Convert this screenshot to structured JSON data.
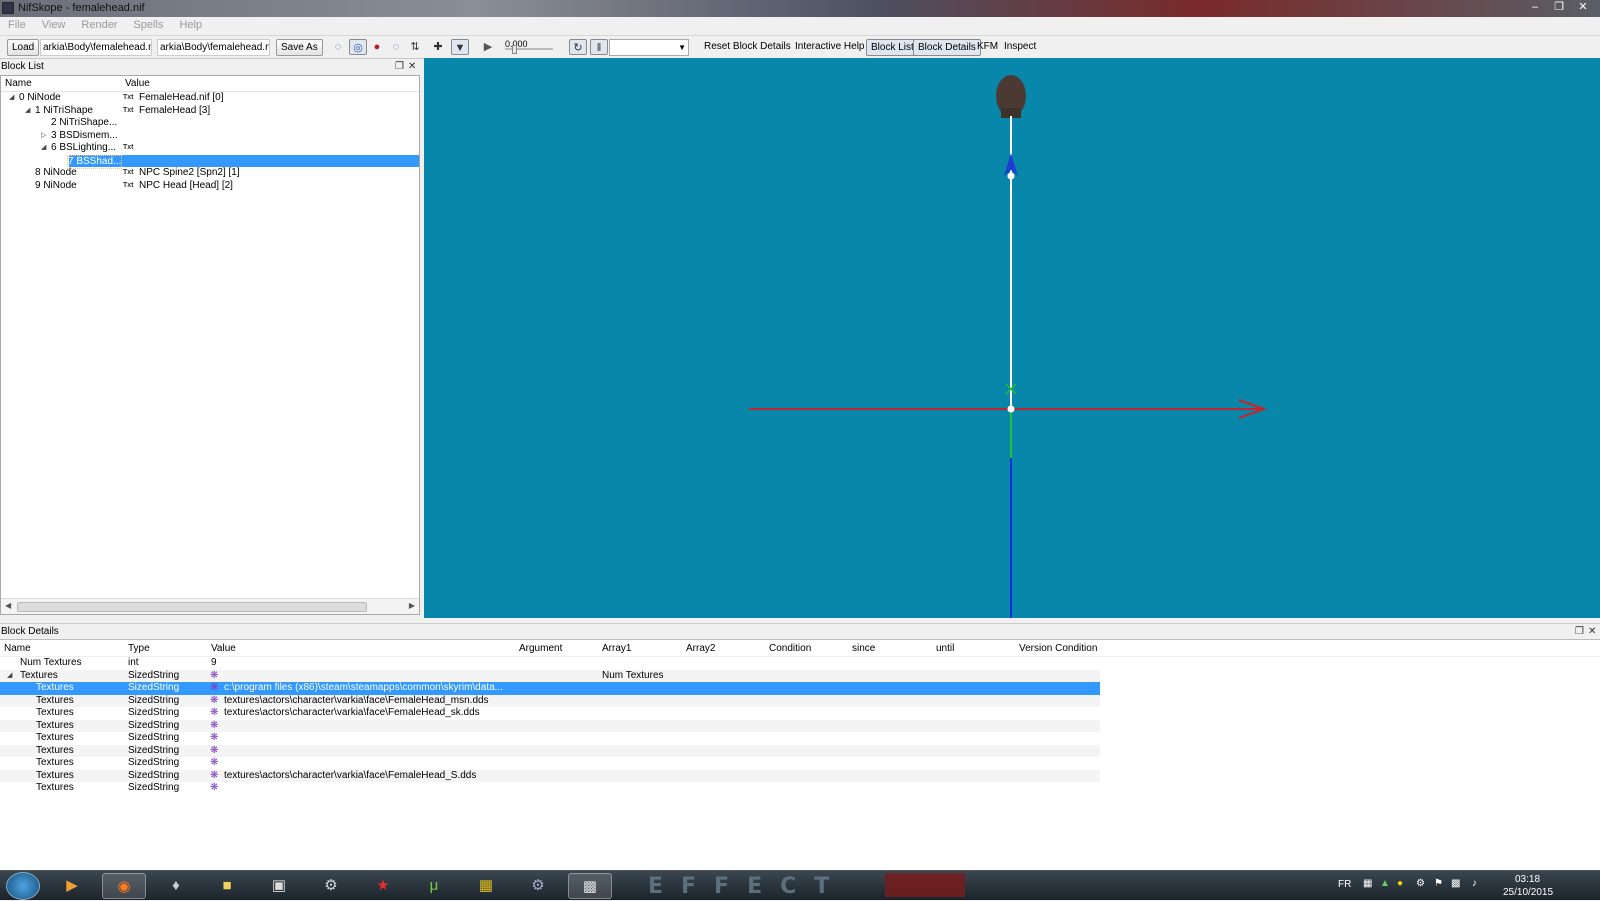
{
  "window": {
    "title": "NifSkope - femalehead.nif"
  },
  "menu": [
    "File",
    "View",
    "Render",
    "Spells",
    "Help"
  ],
  "toolbar": {
    "load_label": "Load",
    "load_path": "arkia\\Body\\femalehead.nif",
    "save_path": "arkia\\Body\\femalehead.nif",
    "save_label": "Save As",
    "time_value": "0.000",
    "reset_label": "Reset Block Details",
    "help_label": "Interactive Help",
    "blocklist_label": "Block List",
    "blockdetails_label": "Block Details",
    "kfm_label": "KFM",
    "inspect_label": "Inspect"
  },
  "block_list": {
    "title": "Block List",
    "col_name": "Name",
    "col_value": "Value",
    "rows": [
      {
        "name": "0 NiNode",
        "value": "FemaleHead.nif [0]",
        "txt": "Txt",
        "expander": "open"
      },
      {
        "name": "1 NiTriShape",
        "value": "FemaleHead [3]",
        "txt": "Txt",
        "expander": "open"
      },
      {
        "name": "2 NiTriShape...",
        "value": "",
        "txt": "",
        "expander": ""
      },
      {
        "name": "3 BSDismem...",
        "value": "",
        "txt": "",
        "expander": "closed"
      },
      {
        "name": "6 BSLighting...",
        "value": "",
        "txt": "Txt",
        "expander": "open"
      },
      {
        "name": "7 BSShad...",
        "value": "",
        "txt": "",
        "expander": "",
        "selected": true
      },
      {
        "name": "8 NiNode",
        "value": "NPC Spine2 [Spn2] [1]",
        "txt": "Txt",
        "expander": ""
      },
      {
        "name": "9 NiNode",
        "value": "NPC Head [Head] [2]",
        "txt": "Txt",
        "expander": ""
      }
    ]
  },
  "block_details": {
    "title": "Block Details",
    "columns": [
      "Name",
      "Type",
      "Value",
      "Argument",
      "Array1",
      "Array2",
      "Condition",
      "since",
      "until",
      "Version Condition"
    ],
    "rows": [
      {
        "name": "Num Textures",
        "type": "int",
        "value": "9",
        "array1": "",
        "icon": false
      },
      {
        "name": "Textures",
        "type": "SizedString",
        "value": "",
        "array1": "Num Textures",
        "icon": true,
        "expander": "open"
      },
      {
        "name": "Textures",
        "type": "SizedString",
        "value": "c:\\program files (x86)\\steam\\steamapps\\common\\skyrim\\data...",
        "array1": "",
        "icon": true,
        "selected": true
      },
      {
        "name": "Textures",
        "type": "SizedString",
        "value": "textures\\actors\\character\\varkia\\face\\FemaleHead_msn.dds",
        "array1": "",
        "icon": true
      },
      {
        "name": "Textures",
        "type": "SizedString",
        "value": "textures\\actors\\character\\varkia\\face\\FemaleHead_sk.dds",
        "array1": "",
        "icon": true
      },
      {
        "name": "Textures",
        "type": "SizedString",
        "value": "",
        "array1": "",
        "icon": true
      },
      {
        "name": "Textures",
        "type": "SizedString",
        "value": "",
        "array1": "",
        "icon": true
      },
      {
        "name": "Textures",
        "type": "SizedString",
        "value": "",
        "array1": "",
        "icon": true
      },
      {
        "name": "Textures",
        "type": "SizedString",
        "value": "",
        "array1": "",
        "icon": true
      },
      {
        "name": "Textures",
        "type": "SizedString",
        "value": "textures\\actors\\character\\varkia\\face\\FemaleHead_S.dds",
        "array1": "",
        "icon": true
      },
      {
        "name": "Textures",
        "type": "SizedString",
        "value": "",
        "array1": "",
        "icon": true
      }
    ]
  },
  "taskbar": {
    "effect_text": "EFFECT",
    "lang": "FR",
    "time": "03:18",
    "date": "25/10/2015"
  },
  "colors": {
    "viewport": "#0987aa",
    "selection": "#3399ff",
    "axis_x": "#d0202a",
    "axis_y": "#22cc33",
    "axis_z": "#1530d8"
  }
}
